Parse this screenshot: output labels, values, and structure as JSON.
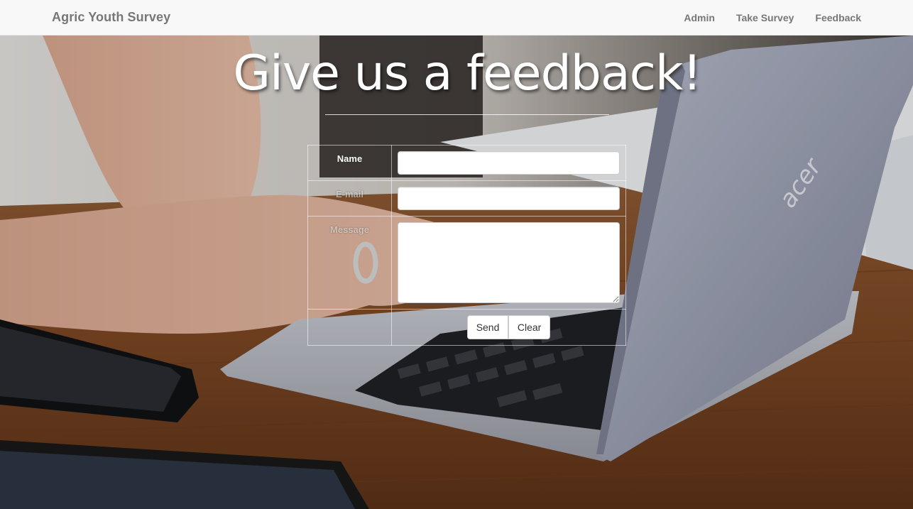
{
  "navbar": {
    "brand": "Agric Youth Survey",
    "links": [
      {
        "label": "Admin"
      },
      {
        "label": "Take Survey"
      },
      {
        "label": "Feedback"
      }
    ],
    "background": "#f8f8f8",
    "text_color": "#777777"
  },
  "hero": {
    "headline": "Give us a feedback!"
  },
  "form": {
    "name_label": "Name",
    "email_label": "E-mail",
    "message_label": "Message",
    "name_value": "",
    "email_value": "",
    "message_value": "",
    "send_label": "Send",
    "clear_label": "Clear"
  },
  "background_image": {
    "icons": [
      "laptop-icon",
      "smartphone-icon",
      "tablet-icon"
    ],
    "laptop_logo": "acer"
  }
}
